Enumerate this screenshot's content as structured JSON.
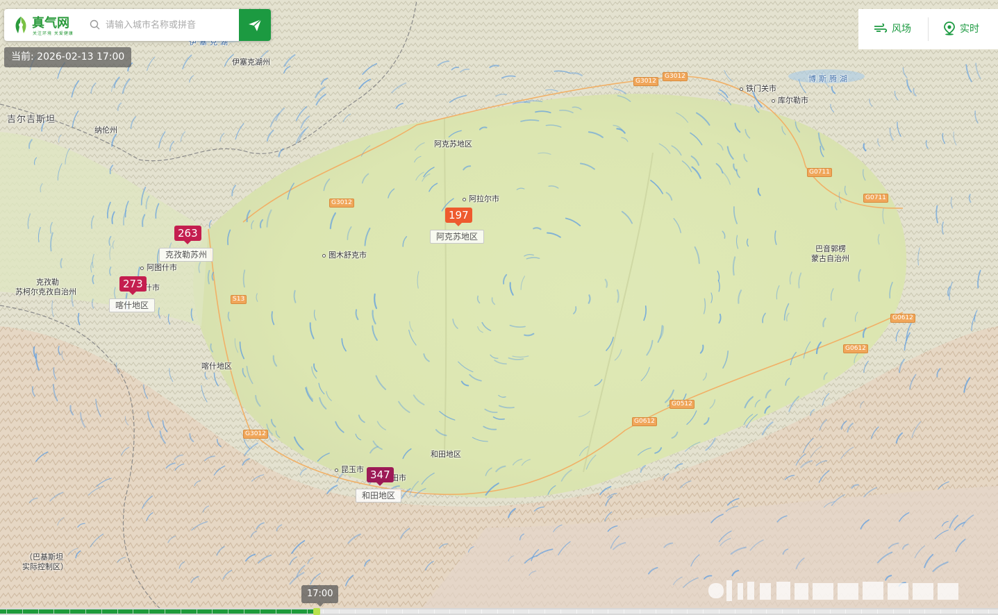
{
  "brand": {
    "name": "真气网",
    "slogan": "关注环境 关爱健康",
    "logo_color": "#2a9a3b"
  },
  "search": {
    "placeholder": "请输入城市名称或拼音",
    "button_icon": "send-icon"
  },
  "time_badge": "当前: 2026-02-13 17:00",
  "tools": {
    "wind_label": "风场",
    "wind_icon": "wind-icon",
    "realtime_label": "实时",
    "realtime_icon": "location-pin-icon"
  },
  "timeline": {
    "current_label": "17:00",
    "accent": "#1f9a3a"
  },
  "aqi_markers": [
    {
      "value": "197",
      "region": "阿克苏地区",
      "color": "#ee5a2e"
    },
    {
      "value": "263",
      "region": "克孜勒苏州",
      "color": "#c41e4f"
    },
    {
      "value": "273",
      "region": "喀什地区",
      "color": "#c41e4f"
    },
    {
      "value": "347",
      "region": "和田地区",
      "color": "#9c1a56"
    }
  ],
  "map_labels": {
    "akesu_area": "阿克苏地区",
    "alaer": "阿拉尔市",
    "tumushuke": "图木舒克市",
    "atushi": "阿图什市",
    "kashi_city": "什市",
    "kizilsu": "克孜勒\n苏柯尔克孜自治州",
    "kizilsu_line1": "克孜勒",
    "kizilsu_line2": "苏柯尔克孜自治州",
    "kashi_area": "喀什地区",
    "hotan_area": "和田地区",
    "kunyu": "昆玉市",
    "hotan_city": "田市",
    "tiemenguan": "铁门关市",
    "korla": "库尔勒市",
    "bayingol_line1": "巴音郭楞",
    "bayingol_line2": "蒙古自治州",
    "bosten_lake": "博斯腾湖",
    "issyk_kul_lake": "伊塞克湖州",
    "issyk_kul_water": "伊塞克湖",
    "kyrgyzstan": "吉尔吉斯坦",
    "naryn": "纳伦州",
    "pakistan_line1": "（巴基斯坦",
    "pakistan_line2": "实际控制区）"
  },
  "roads": [
    "G3012",
    "G3012",
    "G3012",
    "S13",
    "G3012",
    "G0711",
    "G0711",
    "G0612",
    "G0612",
    "G0612",
    "G0512"
  ]
}
